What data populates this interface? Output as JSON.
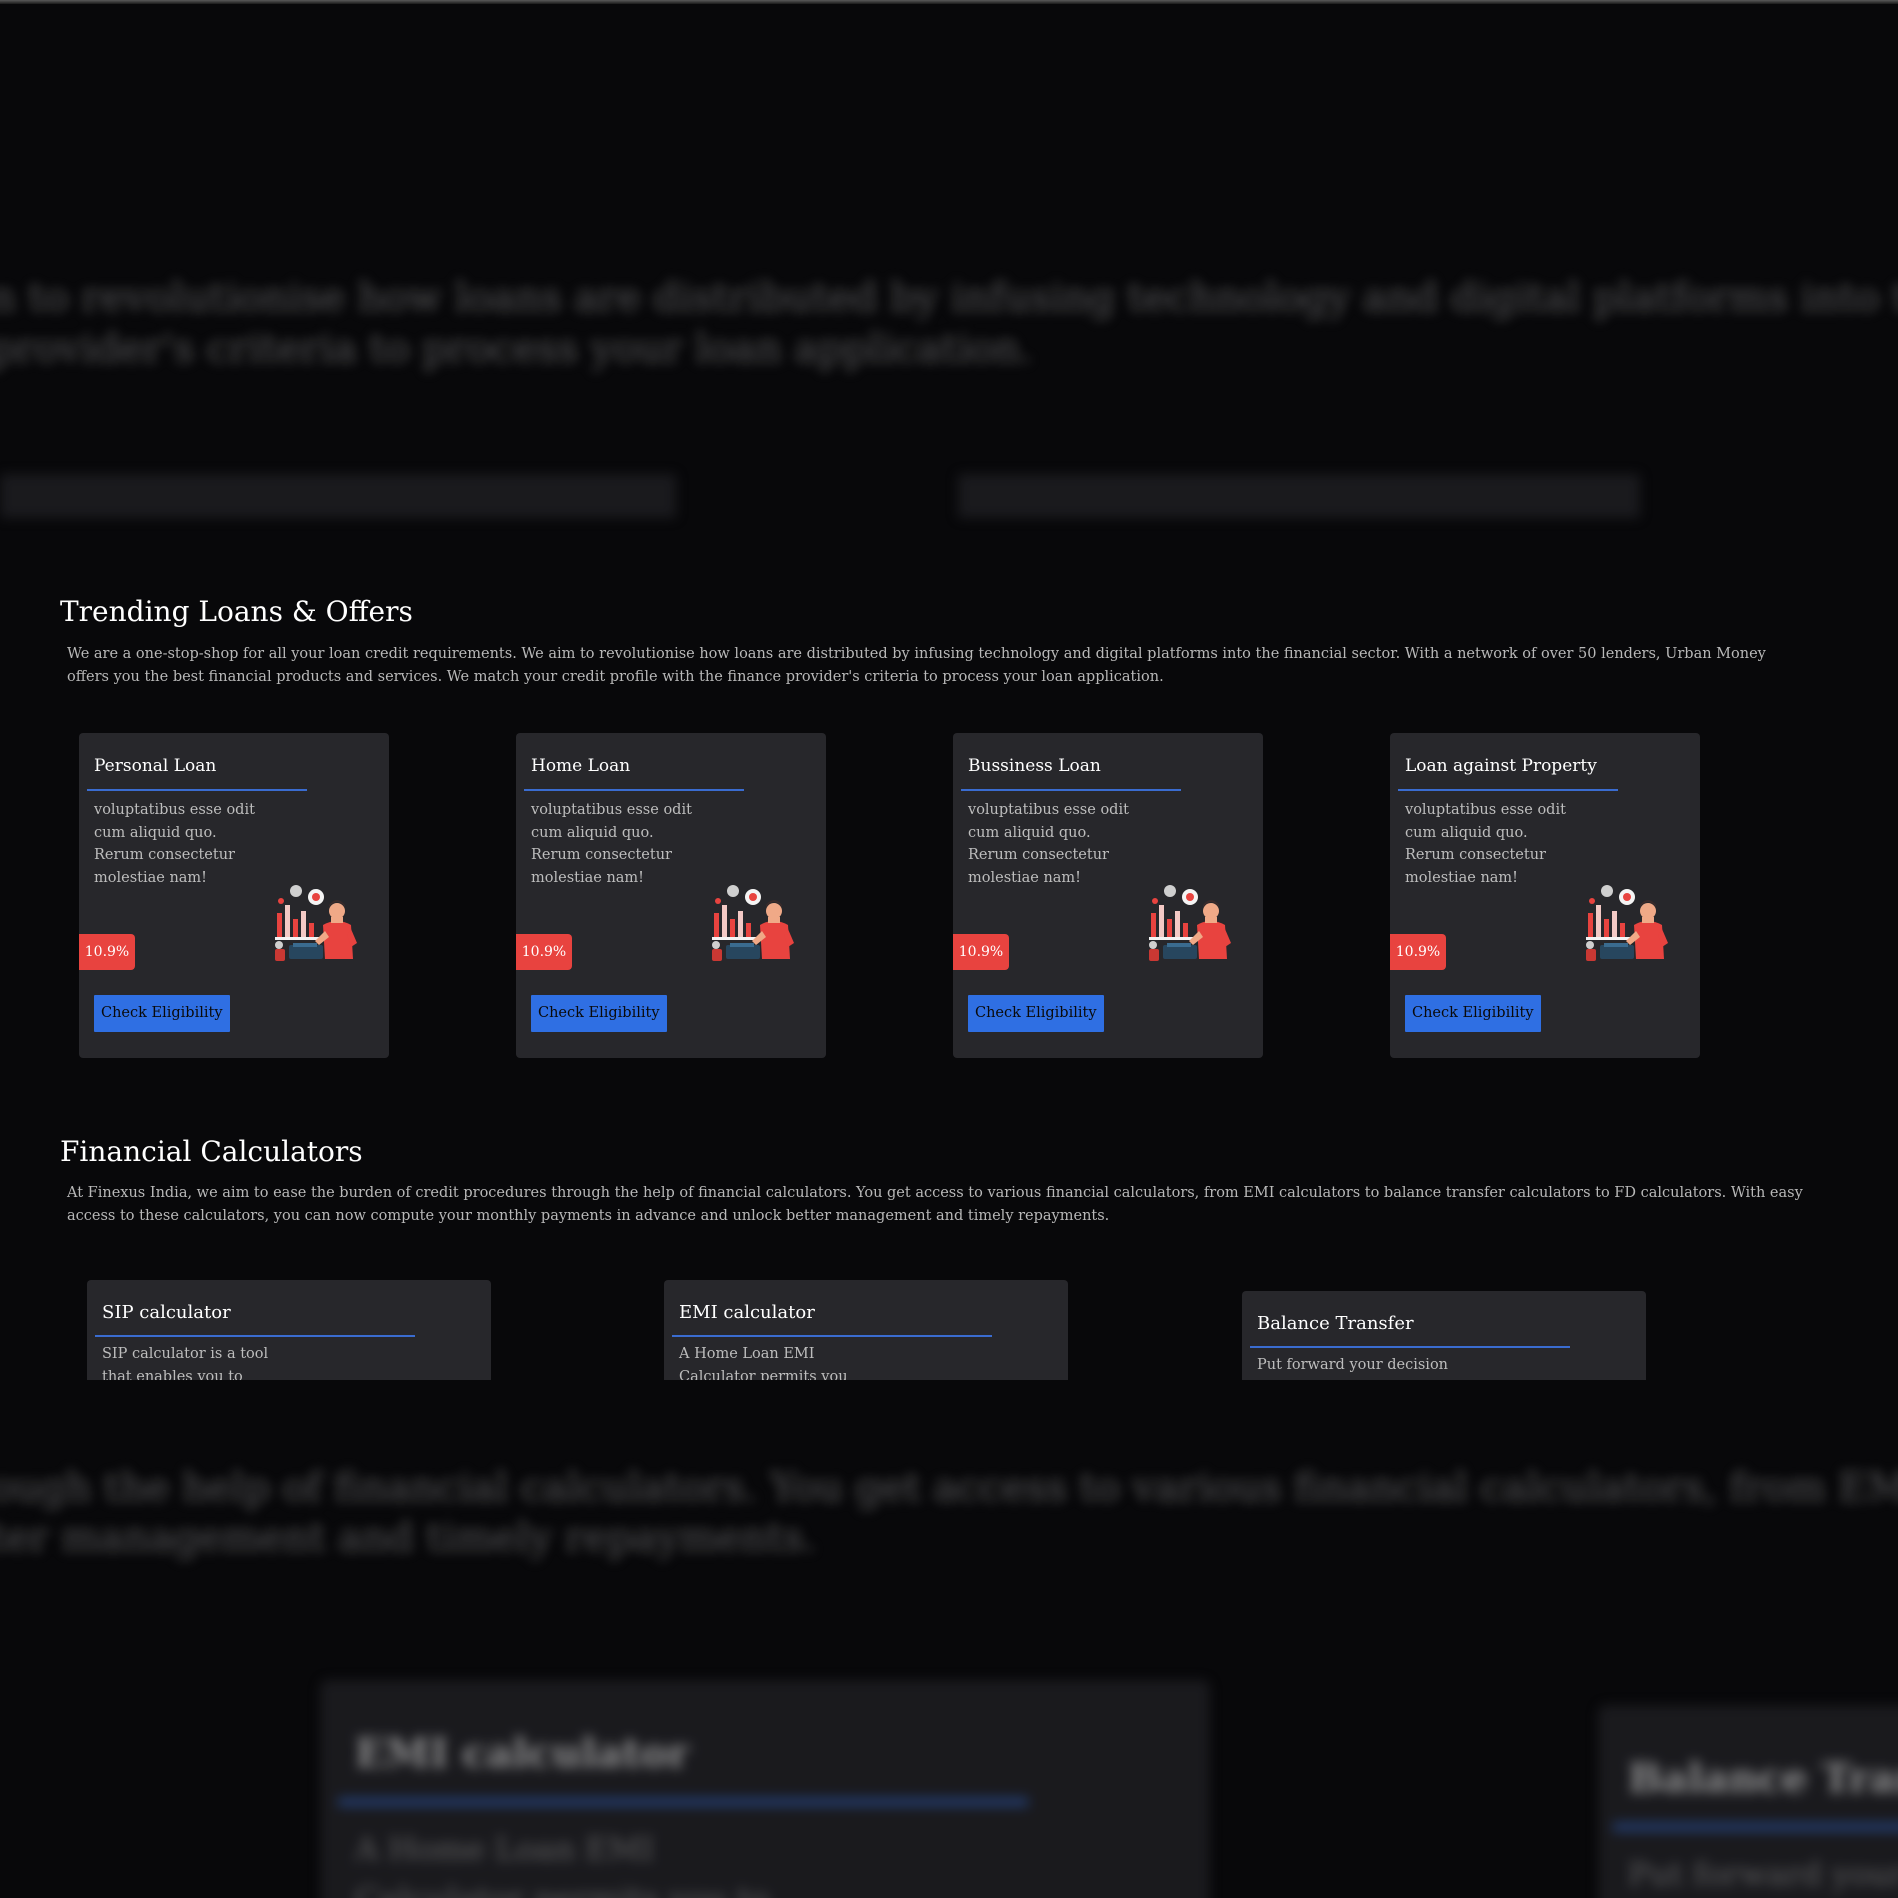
{
  "background": {
    "lines": [
      "n to revolutionise how loans are distributed by infusing technology and digital platforms into the financial sector. With a network o",
      " provider's criteria to process your loan application.",
      "ough the help of financial calculators. You get access to various financial calculators, from EMI calculators to balance transfer calcu",
      "ter management and timely repayments."
    ],
    "emi_title": "EMI calculator",
    "emi_desc_1": "A Home Loan EMI",
    "emi_desc_2": "Calculator permits you to",
    "bt_title": "Balance Transf",
    "bt_desc": "Put forward your"
  },
  "trending": {
    "title": "Trending Loans & Offers",
    "description": "We are a one-stop-shop for all your loan credit requirements. We aim to revolutionise how loans are distributed by infusing technology and digital platforms into the financial sector. With a network of over 50 lenders, Urban Money offers you the best financial products and services. We match your credit profile with the finance provider's criteria to process your loan application.",
    "cards": [
      {
        "title": "Personal Loan",
        "description": "voluptatibus esse odit cum aliquid quo. Rerum consectetur molestiae nam!",
        "rate": "10.9%",
        "button": "Check Eligibility"
      },
      {
        "title": "Home Loan",
        "description": "voluptatibus esse odit cum aliquid quo. Rerum consectetur molestiae nam!",
        "rate": "10.9%",
        "button": "Check Eligibility"
      },
      {
        "title": "Bussiness Loan",
        "description": "voluptatibus esse odit cum aliquid quo. Rerum consectetur molestiae nam!",
        "rate": "10.9%",
        "button": "Check Eligibility"
      },
      {
        "title": "Loan against Property",
        "description": "voluptatibus esse odit cum aliquid quo. Rerum consectetur molestiae nam!",
        "rate": "10.9%",
        "button": "Check Eligibility"
      }
    ]
  },
  "calculators": {
    "title": "Financial Calculators",
    "description": "At Finexus India, we aim to ease the burden of credit procedures through the help of financial calculators. You get access to various financial calculators, from EMI calculators to balance transfer calculators to FD calculators. With easy access to these calculators, you can now compute your monthly payments in advance and unlock better management and timely repayments.",
    "cards": [
      {
        "title": "SIP calculator",
        "description": "SIP calculator is a tool that enables you to"
      },
      {
        "title": "EMI calculator",
        "description": "A Home Loan EMI Calculator permits you to"
      },
      {
        "title": "Balance Transfer",
        "description": "Put forward your decision"
      }
    ]
  },
  "colors": {
    "page_bg": "#08080a",
    "card_bg": "#27272b",
    "accent_blue": "#2f6fe3",
    "underline_blue": "#3a6cd0",
    "rate_red": "#e8433f"
  }
}
